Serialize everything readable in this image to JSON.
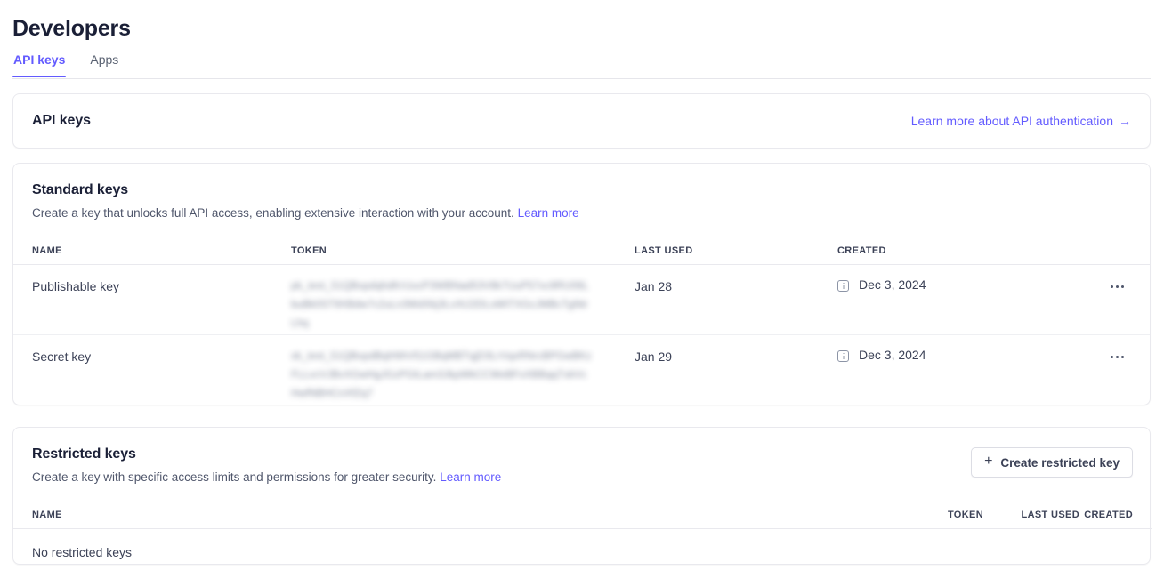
{
  "page": {
    "title": "Developers"
  },
  "tabs": [
    {
      "label": "API keys",
      "active": true
    },
    {
      "label": "Apps",
      "active": false
    }
  ],
  "api_keys_card": {
    "title": "API keys",
    "learn_more_link": "Learn more about API authentication",
    "arrow_icon": "arrow-right-icon"
  },
  "standard_keys": {
    "title": "Standard keys",
    "description": "Create a key that unlocks full API access, enabling extensive interaction with your account.",
    "learn_more": "Learn more",
    "columns": [
      "NAME",
      "TOKEN",
      "LAST USED",
      "CREATED"
    ],
    "rows": [
      {
        "name": "Publishable key",
        "token": "pk_test_51QBopdqhdKrUucP3WBNad53V8k7UuP57xc9RU06LbuBk0ST9XBdw7c2uLn3WdXkj3LvXtJ2DLsWtTXGcJMBcTgNtrLhq",
        "last_used": "Jan 28",
        "created": "Dec 3, 2024",
        "created_icon": "info-icon",
        "menu_icon": "overflow-menu-icon"
      },
      {
        "name": "Secret key",
        "token": "sk_test_51QBopdBqhNhV51GBqMBTqjD3LrVqxRNrcBPGwBKzFLLvcVJBvXGwHgJGzPGtLam3JkpWkCCWeBFxXBBqqTxkVcHwfNBHCnXfZq7",
        "last_used": "Jan 29",
        "created": "Dec 3, 2024",
        "created_icon": "info-icon",
        "menu_icon": "overflow-menu-icon"
      }
    ]
  },
  "restricted_keys": {
    "title": "Restricted keys",
    "description": "Create a key with specific access limits and permissions for greater security.",
    "learn_more": "Learn more",
    "create_button": "Create restricted key",
    "plus_icon": "plus-icon",
    "columns": [
      "NAME",
      "TOKEN",
      "LAST USED",
      "CREATED"
    ],
    "empty_message": "No restricted keys"
  },
  "colors": {
    "accent": "#635bff",
    "text_primary": "#1a1f36",
    "text_secondary": "#4f566b",
    "border": "#e9e9ee",
    "background": "#ffffff"
  }
}
